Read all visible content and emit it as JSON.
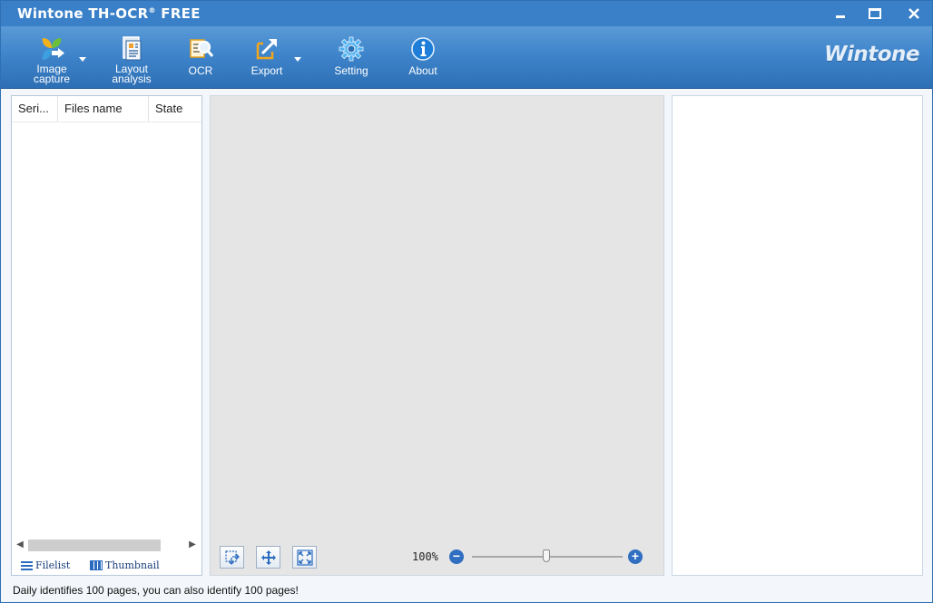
{
  "window": {
    "title_main": "Wintone TH-OCR",
    "title_reg": "®",
    "title_edition": "FREE"
  },
  "toolbar": {
    "items": [
      {
        "label": "Image capture",
        "icon": "image-capture-icon",
        "has_dropdown": true
      },
      {
        "label": "Layout analysis",
        "icon": "layout-analysis-icon",
        "has_dropdown": false
      },
      {
        "label": "OCR",
        "icon": "ocr-icon",
        "has_dropdown": false
      },
      {
        "label": "Export",
        "icon": "export-icon",
        "has_dropdown": true
      },
      {
        "label": "Setting",
        "icon": "gear-icon",
        "has_dropdown": false
      },
      {
        "label": "About",
        "icon": "info-icon",
        "has_dropdown": false
      }
    ],
    "brand": "Wintone"
  },
  "file_list": {
    "columns": [
      "Seri...",
      "Files name",
      "State"
    ],
    "rows": []
  },
  "view_tabs": {
    "filelist": "Filelist",
    "thumbnail": "Thumbnail"
  },
  "viewer": {
    "zoom": "100%",
    "zoom_fraction": 0.5
  },
  "status": {
    "text": "Daily identifies 100 pages, you can also identify 100 pages!"
  },
  "colors": {
    "titlebar": "#3a80c8",
    "toolbar": "#3f85cb",
    "accent": "#2f6ec0"
  }
}
